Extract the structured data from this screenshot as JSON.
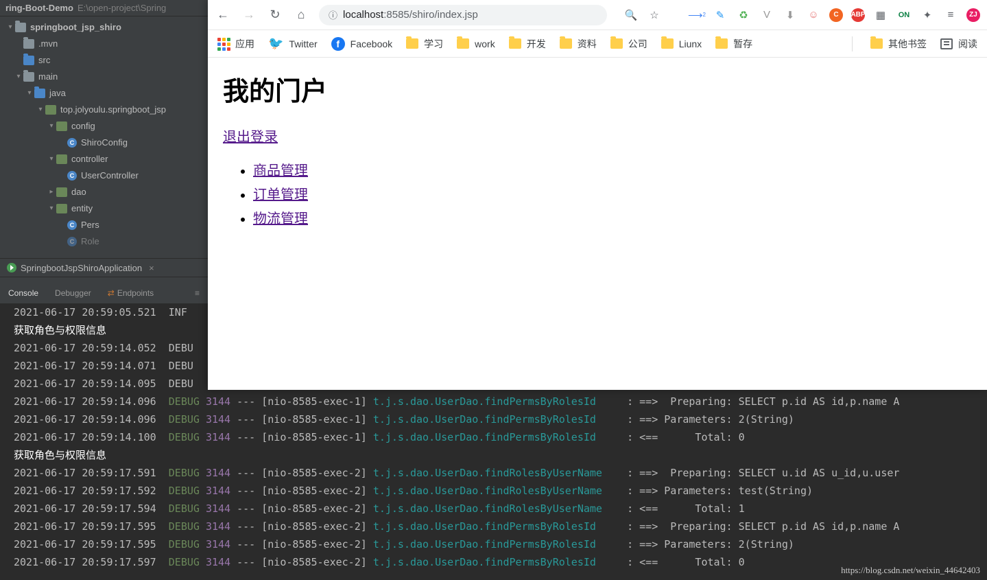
{
  "ide": {
    "project_name": "ring-Boot-Demo",
    "project_path": "E:\\open-project\\Spring",
    "tree": {
      "root": "springboot_jsp_shiro",
      "mvn": ".mvn",
      "src": "src",
      "main": "main",
      "java": "java",
      "pkg": "top.jolyoulu.springboot_jsp",
      "config": "config",
      "shiro_config": "ShiroConfig",
      "controller": "controller",
      "user_controller": "UserController",
      "dao": "dao",
      "entity": "entity",
      "pers": "Pers",
      "role": "Role"
    },
    "open_tab": "SpringbootJspShiroApplication",
    "tool_tabs": {
      "console": "Console",
      "debugger": "Debugger",
      "endpoints": "Endpoints"
    }
  },
  "console_lines": [
    {
      "ts": "2021-06-17 20:59:05.521",
      "lvl": "INF",
      "rest": ""
    },
    {
      "cn": "获取角色与权限信息"
    },
    {
      "ts": "2021-06-17 20:59:14.052",
      "lvl": "DEBU",
      "rest": ""
    },
    {
      "ts": "2021-06-17 20:59:14.071",
      "lvl": "DEBU",
      "rest": ""
    },
    {
      "ts": "2021-06-17 20:59:14.095",
      "lvl": "DEBU",
      "rest": ""
    },
    {
      "ts": "2021-06-17 20:59:14.096",
      "lvl": "DEBUG",
      "pid": "3144",
      "thr": "[nio-8585-exec-1]",
      "cls": "t.j.s.dao.UserDao.findPermsByRolesId",
      "msg": ": ==>  Preparing: SELECT p.id AS id,p.name A"
    },
    {
      "ts": "2021-06-17 20:59:14.096",
      "lvl": "DEBUG",
      "pid": "3144",
      "thr": "[nio-8585-exec-1]",
      "cls": "t.j.s.dao.UserDao.findPermsByRolesId",
      "msg": ": ==> Parameters: 2(String)"
    },
    {
      "ts": "2021-06-17 20:59:14.100",
      "lvl": "DEBUG",
      "pid": "3144",
      "thr": "[nio-8585-exec-1]",
      "cls": "t.j.s.dao.UserDao.findPermsByRolesId",
      "msg": ": <==      Total: 0"
    },
    {
      "cn": "获取角色与权限信息"
    },
    {
      "ts": "2021-06-17 20:59:17.591",
      "lvl": "DEBUG",
      "pid": "3144",
      "thr": "[nio-8585-exec-2]",
      "cls": "t.j.s.dao.UserDao.findRolesByUserName",
      "msg": ": ==>  Preparing: SELECT u.id AS u_id,u.user"
    },
    {
      "ts": "2021-06-17 20:59:17.592",
      "lvl": "DEBUG",
      "pid": "3144",
      "thr": "[nio-8585-exec-2]",
      "cls": "t.j.s.dao.UserDao.findRolesByUserName",
      "msg": ": ==> Parameters: test(String)"
    },
    {
      "ts": "2021-06-17 20:59:17.594",
      "lvl": "DEBUG",
      "pid": "3144",
      "thr": "[nio-8585-exec-2]",
      "cls": "t.j.s.dao.UserDao.findRolesByUserName",
      "msg": ": <==      Total: 1"
    },
    {
      "ts": "2021-06-17 20:59:17.595",
      "lvl": "DEBUG",
      "pid": "3144",
      "thr": "[nio-8585-exec-2]",
      "cls": "t.j.s.dao.UserDao.findPermsByRolesId",
      "msg": ": ==>  Preparing: SELECT p.id AS id,p.name A"
    },
    {
      "ts": "2021-06-17 20:59:17.595",
      "lvl": "DEBUG",
      "pid": "3144",
      "thr": "[nio-8585-exec-2]",
      "cls": "t.j.s.dao.UserDao.findPermsByRolesId",
      "msg": ": ==> Parameters: 2(String)"
    },
    {
      "ts": "2021-06-17 20:59:17.597",
      "lvl": "DEBUG",
      "pid": "3144",
      "thr": "[nio-8585-exec-2]",
      "cls": "t.j.s.dao.UserDao.findPermsByRolesId",
      "msg": ": <==      Total: 0"
    }
  ],
  "watermark": "https://blog.csdn.net/weixin_44642403",
  "browser": {
    "url_host": "localhost",
    "url_port": ":8585",
    "url_path": "/shiro/index.jsp",
    "bookmarks": {
      "apps": "应用",
      "twitter": "Twitter",
      "facebook": "Facebook",
      "study": "学习",
      "work": "work",
      "dev": "开发",
      "data": "资料",
      "company": "公司",
      "linux": "Liunx",
      "temp": "暂存",
      "other": "其他书签",
      "read": "阅读"
    },
    "page": {
      "title": "我的门户",
      "logout": "退出登录",
      "menu": [
        "商品管理",
        "订单管理",
        "物流管理"
      ]
    },
    "avatar_text": "ZJ"
  }
}
